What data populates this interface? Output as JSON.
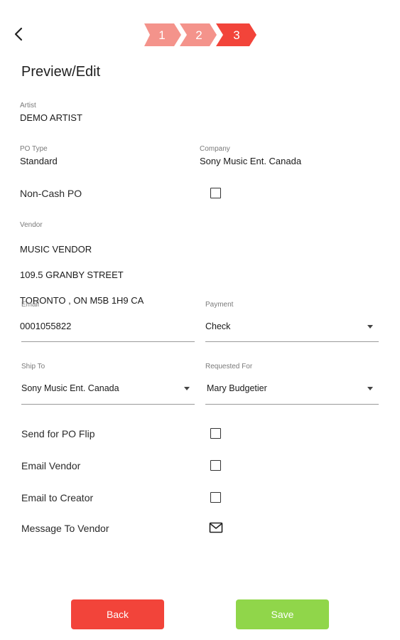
{
  "header": {
    "steps": [
      "1",
      "2",
      "3"
    ],
    "colors": {
      "step_done": "#f4938b",
      "step_active": "#f2443a"
    },
    "title": "Preview/Edit"
  },
  "form": {
    "artist": {
      "label": "Artist",
      "value": "DEMO ARTIST"
    },
    "po_type": {
      "label": "PO Type",
      "value": "Standard"
    },
    "company": {
      "label": "Company",
      "value": "Sony Music Ent. Canada"
    },
    "non_cash_po": {
      "label": "Non-Cash PO",
      "checked": false
    },
    "vendor": {
      "label": "Vendor",
      "lines": [
        "MUSIC VENDOR",
        "109.5 GRANBY STREET",
        "TORONTO , ON M5B 1H9 CA",
        "0001055822"
      ]
    },
    "email": {
      "label": "Email",
      "value": ""
    },
    "payment": {
      "label": "Payment",
      "value": "Check"
    },
    "ship_to": {
      "label": "Ship To",
      "value": "Sony Music Ent. Canada"
    },
    "requested_for": {
      "label": "Requested For",
      "value": "Mary Budgetier"
    },
    "send_for_po_flip": {
      "label": "Send for PO Flip",
      "checked": false
    },
    "email_vendor": {
      "label": "Email Vendor",
      "checked": false
    },
    "email_to_creator": {
      "label": "Email to Creator",
      "checked": false
    },
    "message_to_vendor": {
      "label": "Message To Vendor",
      "icon": "envelope-icon"
    }
  },
  "buttons": {
    "back": "Back",
    "save": "Save",
    "colors": {
      "back": "#f2443a",
      "save": "#90d64a"
    }
  }
}
